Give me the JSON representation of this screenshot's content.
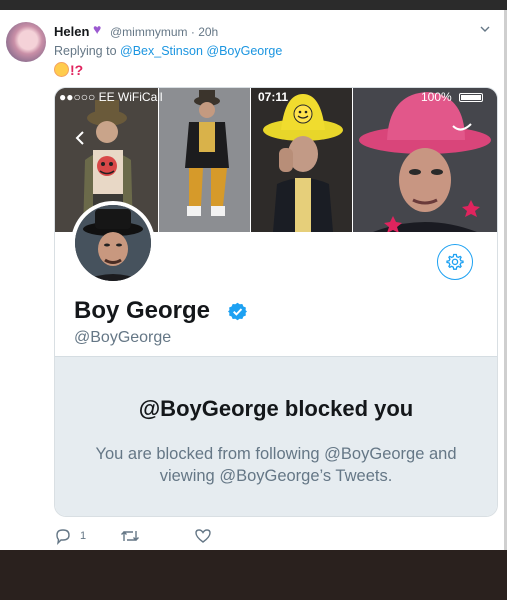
{
  "tweet": {
    "author_name": "Helen",
    "author_handle": "@mimmymum",
    "time": "· 20h",
    "replying_prefix": "Replying to",
    "reply_to_1": "@Bex_Stinson",
    "reply_to_2": "@BoyGeorge",
    "emoji_text": "!?",
    "reply_count": "1",
    "icons": [
      "chevron-down-icon",
      "reply-icon",
      "retweet-icon",
      "heart-icon",
      "purple-heart-icon"
    ]
  },
  "screenshot": {
    "status_carrier": "●●○○○ EE WiFiCall",
    "status_time": "07:11",
    "status_battery": "100%",
    "profile_name": "Boy George",
    "profile_handle": "@BoyGeorge",
    "blocked_title": "@BoyGeorge blocked you",
    "blocked_message": "You are blocked from following @BoyGeorge and viewing @BoyGeorge’s Tweets.",
    "icons": [
      "gear-icon",
      "verified-badge-icon"
    ],
    "accent_color": "#1da1f2"
  }
}
